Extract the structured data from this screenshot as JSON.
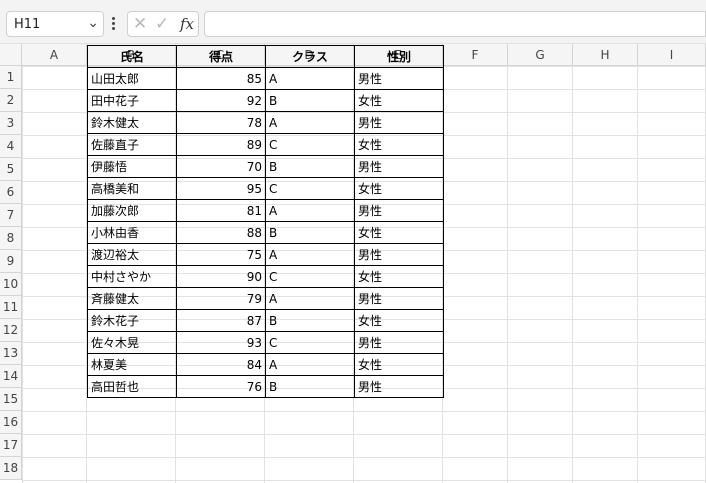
{
  "formula_bar": {
    "name_box": "H11",
    "formula": ""
  },
  "columns": [
    "A",
    "B",
    "C",
    "D",
    "E",
    "F",
    "G",
    "H",
    "I"
  ],
  "rows": [
    "1",
    "2",
    "3",
    "4",
    "5",
    "6",
    "7",
    "8",
    "9",
    "10",
    "11",
    "12",
    "13",
    "14",
    "15",
    "16",
    "17",
    "18"
  ],
  "table": {
    "headers": [
      "氏名",
      "得点",
      "クラス",
      "性別"
    ],
    "rows": [
      [
        "山田太郎",
        "85",
        "A",
        "男性"
      ],
      [
        "田中花子",
        "92",
        "B",
        "女性"
      ],
      [
        "鈴木健太",
        "78",
        "A",
        "男性"
      ],
      [
        "佐藤直子",
        "89",
        "C",
        "女性"
      ],
      [
        "伊藤悟",
        "70",
        "B",
        "男性"
      ],
      [
        "高橋美和",
        "95",
        "C",
        "女性"
      ],
      [
        "加藤次郎",
        "81",
        "A",
        "男性"
      ],
      [
        "小林由香",
        "88",
        "B",
        "女性"
      ],
      [
        "渡辺裕太",
        "75",
        "A",
        "男性"
      ],
      [
        "中村さやか",
        "90",
        "C",
        "女性"
      ],
      [
        "斉藤健太",
        "79",
        "A",
        "男性"
      ],
      [
        "鈴木花子",
        "87",
        "B",
        "女性"
      ],
      [
        "佐々木晃",
        "93",
        "C",
        "男性"
      ],
      [
        "林夏美",
        "84",
        "A",
        "女性"
      ],
      [
        "高田哲也",
        "76",
        "B",
        "男性"
      ]
    ]
  },
  "icons": {
    "name_box_dropdown": "chevron-down-icon",
    "more_options": "kebab-icon",
    "cancel": "close-icon",
    "enter": "check-icon",
    "insert_function": "function-icon"
  }
}
